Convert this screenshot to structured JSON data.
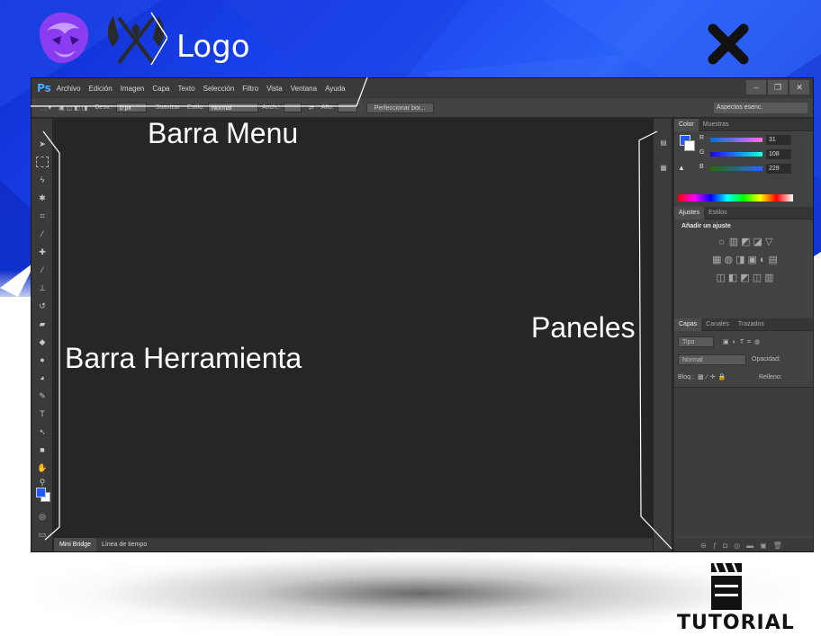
{
  "header": {
    "logo_label": "Logo",
    "close_icon": "close-icon",
    "lion_icon": "lion-logo-icon",
    "axe_icon": "crossed-axes-logo-icon"
  },
  "colors": {
    "banner_blue": "#1a44f0",
    "ps_blue": "#4aa8ff",
    "canvas": "#262626",
    "foreground_color": "#1f5aff"
  },
  "ps": {
    "app_icon": "Ps",
    "menu": [
      "Archivo",
      "Edición",
      "Imagen",
      "Capa",
      "Texto",
      "Selección",
      "Filtro",
      "Vista",
      "Ventana",
      "Ayuda"
    ],
    "window_controls": [
      "–",
      "❐",
      "✕"
    ],
    "options": {
      "desv_label": "Desv.:",
      "desv_value": "0 px",
      "suavizar": "Suavizar",
      "estilo_label": "Estilo:",
      "estilo_value": "Normal",
      "anch_label": "Anch.:",
      "alto_label": "Alto:",
      "refine_button": "Perfeccionar bor...",
      "workspace": "Aspectos esenc."
    },
    "doc_tabs": [
      "Mini Bridge",
      "Línea de tiempo"
    ],
    "panels": {
      "color_tabs": [
        "Color",
        "Muestras"
      ],
      "rgb": [
        {
          "label": "R",
          "value": "31"
        },
        {
          "label": "G",
          "value": "108"
        },
        {
          "label": "B",
          "value": "229"
        }
      ],
      "adjust_tabs": [
        "Ajustes",
        "Estilos"
      ],
      "adjust_title": "Añadir un ajuste",
      "layer_tabs": [
        "Capas",
        "Canales",
        "Trazados"
      ],
      "layer_filter": "Tipo",
      "blend_mode": "Normal",
      "opacity_label": "Opacidad:",
      "lock_label": "Bloq.:",
      "fill_label": "Relleno:"
    }
  },
  "annotations": {
    "menu": "Barra Menu",
    "tools": "Barra Herramienta",
    "panels": "Paneles"
  },
  "footer": {
    "tutorial": "TUTORIAL",
    "tutorial_icon": "clapperboard-icon"
  }
}
